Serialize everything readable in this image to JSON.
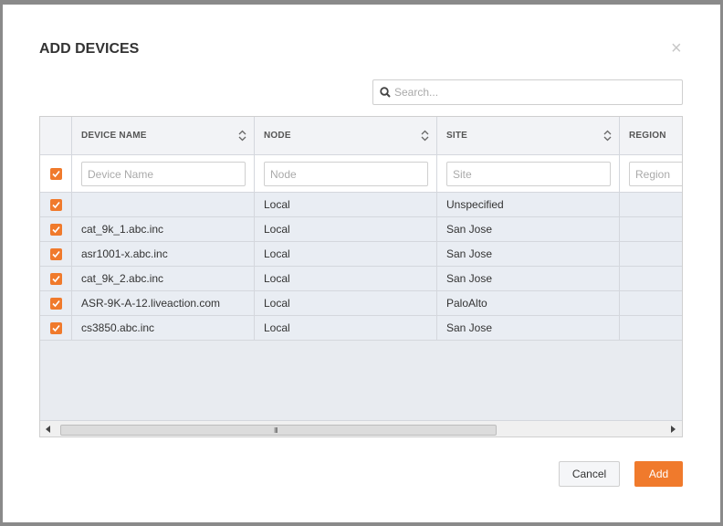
{
  "dialog": {
    "title": "ADD DEVICES",
    "close_symbol": "×"
  },
  "search": {
    "placeholder": "Search...",
    "icon": "search-icon"
  },
  "table": {
    "columns": [
      {
        "label": "DEVICE NAME",
        "filter_placeholder": "Device Name"
      },
      {
        "label": "NODE",
        "filter_placeholder": "Node"
      },
      {
        "label": "SITE",
        "filter_placeholder": "Site"
      },
      {
        "label": "REGION",
        "filter_placeholder": "Region"
      }
    ],
    "header_checkbox_checked": true,
    "rows": [
      {
        "checked": true,
        "device_name": "",
        "node": "Local",
        "site": "Unspecified",
        "region": ""
      },
      {
        "checked": true,
        "device_name": "cat_9k_1.abc.inc",
        "node": "Local",
        "site": "San Jose",
        "region": ""
      },
      {
        "checked": true,
        "device_name": "asr1001-x.abc.inc",
        "node": "Local",
        "site": "San Jose",
        "region": ""
      },
      {
        "checked": true,
        "device_name": "cat_9k_2.abc.inc",
        "node": "Local",
        "site": "San Jose",
        "region": ""
      },
      {
        "checked": true,
        "device_name": "ASR-9K-A-12.liveaction.com",
        "node": "Local",
        "site": "PaloAlto",
        "region": ""
      },
      {
        "checked": true,
        "device_name": "cs3850.abc.inc",
        "node": "Local",
        "site": "San Jose",
        "region": ""
      }
    ],
    "scrollbar_grip": "III"
  },
  "footer": {
    "cancel_label": "Cancel",
    "add_label": "Add"
  },
  "colors": {
    "accent": "#f07a2c",
    "row_bg": "#e9edf3"
  }
}
